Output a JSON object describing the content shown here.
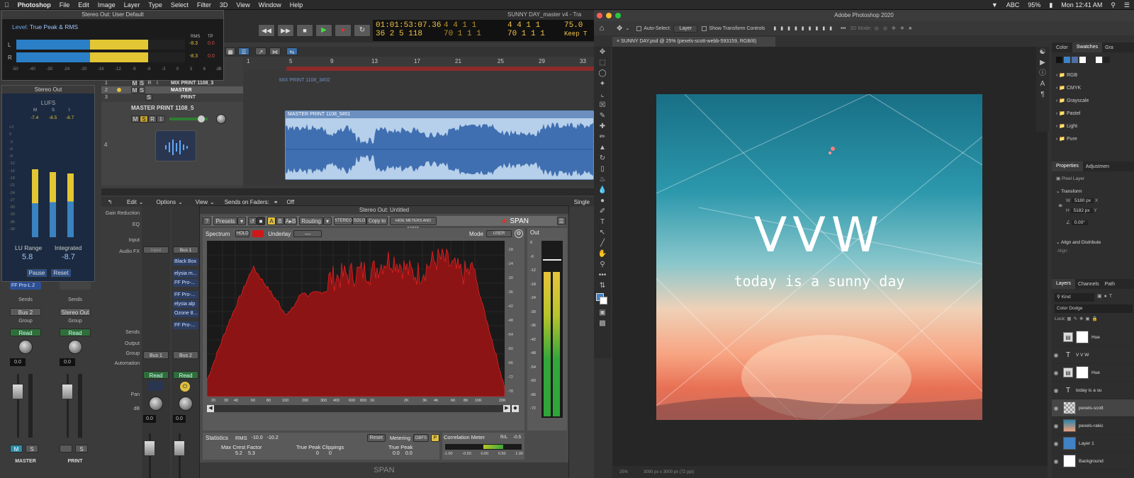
{
  "menubar": {
    "app": "Photoshop",
    "items": [
      "File",
      "Edit",
      "Image",
      "Layer",
      "Type",
      "Select",
      "Filter",
      "3D",
      "View",
      "Window",
      "Help"
    ],
    "battery": "95%",
    "input": "ABC",
    "clock": "Mon 12:41 AM"
  },
  "logic": {
    "window_title": "SUNNY DAY_master v4 - Tra",
    "lcd": {
      "time": "01:01:53:07.36",
      "bars": "36  2  5  118",
      "pos1": "4  4  1  1",
      "pos1b": "70  1  1  1",
      "pos2": "4  4  1  1",
      "pos2b": "70  1  1  1",
      "tempo": "75.0",
      "keep": "Keep T"
    },
    "ruler": [
      "1",
      "5",
      "9",
      "13",
      "17",
      "21",
      "25",
      "29",
      "33"
    ],
    "tracks": [
      {
        "num": "1",
        "name": "MIX PRINT 1108_3"
      },
      {
        "num": "2",
        "name": "MASTER"
      },
      {
        "num": "3",
        "name": "PRINT"
      }
    ],
    "track4": {
      "num": "4",
      "name": "MASTER PRINT 1108_5",
      "m": "M",
      "s": "S",
      "r": "R",
      "i": "I"
    },
    "region_small": "MIX PRINT 1108_3#02",
    "region_main": "MASTER PRINT 1108_5#01",
    "mixer_bar": {
      "edit": "Edit",
      "options": "Options",
      "view": "View",
      "sends_on": "Sends on Faders:",
      "off": "Off",
      "single": "Single"
    },
    "mixer_labels": [
      "Gain Reduction",
      "EQ",
      "Input",
      "Audio FX",
      "Sends",
      "Output",
      "Group",
      "Automation",
      "Pan",
      "dB"
    ],
    "strip_a": {
      "input": "Input",
      "slots": [
        "FF Pro-L 2"
      ],
      "sends": "Sends",
      "output": "Bus 2",
      "group": "Group",
      "read": "Read",
      "db": "0.0",
      "m": "M",
      "s": "S",
      "name": "MASTER"
    },
    "strip_b": {
      "slots": [],
      "sends": "Sends",
      "output": "Stereo Out",
      "group": "Group",
      "read": "Read",
      "db": "0.0",
      "s": "S",
      "name": "PRINT"
    },
    "strip_c": {
      "input": "Input",
      "output": "Bus 1",
      "read": "Read",
      "db": "0.0"
    },
    "strip_d": {
      "input": "Bus 1",
      "slots": [
        "Black Box",
        "elysia m...",
        "FF Pro-...",
        "FF Pro-...",
        "elysia alp",
        "Ozone 8...",
        "FF Pro-..."
      ],
      "output": "Bus 2",
      "read": "Read",
      "db": "0.0"
    }
  },
  "level_meter": {
    "title": "Stereo Out: User Default",
    "level_label": "Level:",
    "mode": "True Peak & RMS",
    "l": "L",
    "r": "R",
    "rms_l": "-8.3",
    "tp_l": "0.0",
    "rms_r": "-8.3",
    "tp_r": "0.0",
    "rms_h": "RMS",
    "tp_h": "TP",
    "scale": [
      "-50",
      "-40",
      "-30",
      "-24",
      "-20",
      "-16",
      "-12",
      "-9",
      "-6",
      "-3",
      "0",
      "3",
      "6",
      "dB"
    ],
    "l_fill": 0.78,
    "r_fill": 0.78
  },
  "loudness": {
    "title": "Stereo Out",
    "lufs": "LUFS",
    "m": "M",
    "s": "S",
    "i": "I",
    "vm": "-7.4",
    "vs": "-8.5",
    "vi": "-8.7",
    "scale": [
      "+3",
      "0",
      "-3",
      "-6",
      "-9",
      "-12",
      "-15",
      "-18",
      "-21",
      "-24",
      "-27",
      "-30",
      "-33",
      "-36",
      "-39"
    ],
    "lu_range_label": "LU Range",
    "lu_range": "5.8",
    "integrated_label": "Integrated",
    "integrated": "-8.7",
    "pause": "Pause",
    "reset": "Reset"
  },
  "span": {
    "title": "Stereo Out: Untitled",
    "presets": "Presets",
    "a": "A",
    "b": "B",
    "atob": "A▸B",
    "routing": "Routing",
    "stereo": "STEREO",
    "solo": "SOLO",
    "copy": "Copy to",
    "hide": "HIDE METERS AND STATS",
    "brand": "SPAN",
    "spectrum": "Spectrum",
    "hold": "HOLD",
    "underlay": "Underlay",
    "underlay_val": "—",
    "mode": "Mode",
    "mode_val": "USER",
    "out": "Out",
    "db_scale": [
      "-18",
      "-24",
      "-30",
      "-36",
      "-42",
      "-48",
      "-54",
      "-60",
      "-66",
      "-72",
      "-78"
    ],
    "freq_scale": [
      "20",
      "30",
      "40",
      "60",
      "80",
      "100",
      "200",
      "300",
      "400",
      "600",
      "800",
      "1K",
      "2K",
      "3K",
      "4K",
      "6K",
      "8K",
      "10K",
      "20K"
    ],
    "statistics": "Statistics",
    "rms": "RMS",
    "rms_l": "-10.0",
    "rms_r": "-10.2",
    "reset": "Reset",
    "metering": "Metering",
    "metering_val": "DBFS",
    "p": "P",
    "corr": "Correlation Meter",
    "rl": "R/L",
    "corr_val": "-0.5",
    "max_crest": "Max Crest Factor",
    "mc_l": "5.2",
    "mc_r": "5.3",
    "tp_clip": "True Peak Clippings",
    "tc_l": "0",
    "tc_r": "0",
    "true_peak": "True Peak",
    "tp_l": "0.0",
    "tp_r": "0.0",
    "corr_scale": [
      "-1.00",
      "-0.50",
      "0.00",
      "0.50",
      "1.00"
    ],
    "footer": "SPAN",
    "out_scale": [
      "0",
      "-6",
      "-12",
      "-18",
      "-24",
      "-30",
      "-36",
      "-42",
      "-48",
      "-54",
      "-60",
      "-66",
      "-72"
    ]
  },
  "photoshop": {
    "title": "Adobe Photoshop 2020",
    "auto_select": "Auto-Select:",
    "layer_sel": "Layer",
    "show_transform": "Show Transform Controls",
    "mode_3d": "3D Mode:",
    "doc_tab": "SUNNY DAY.psd @ 25% (pexels-scott-webb-593159, RGB/8)",
    "art": {
      "title": "VVW",
      "subtitle": "today is a sunny day"
    },
    "status": {
      "zoom": "25%",
      "size": "3000 px x 3000 px (72 ppi)"
    },
    "swatches": {
      "tab_color": "Color",
      "tab_swatches": "Swatches",
      "tab_gr": "Gra",
      "groups": [
        "RGB",
        "CMYK",
        "Grayscale",
        "Pastel",
        "Light",
        "Pure"
      ]
    },
    "properties": {
      "tab": "Properties",
      "tab2": "Adjustmen",
      "pixel_layer": "Pixel Layer",
      "transform": "Transform",
      "w_label": "W",
      "w": "5180 px",
      "x": "X",
      "h_label": "H",
      "h": "5182 px",
      "y": "Y",
      "angle": "0.00°",
      "align": "Align and Distribute",
      "align_label": "Align:"
    },
    "layers": {
      "tab": "Layers",
      "tab2": "Channels",
      "tab3": "Path",
      "kind": "Kind",
      "blend": "Color Dodge",
      "lock": "Lock:",
      "items": [
        {
          "name": "Hue",
          "type": "adj",
          "vis": false
        },
        {
          "name": "V V W",
          "type": "text",
          "vis": true
        },
        {
          "name": "Hue",
          "type": "adj",
          "vis": true
        },
        {
          "name": "today is a su",
          "type": "text",
          "vis": true
        },
        {
          "name": "pexels-scott",
          "type": "image",
          "vis": true
        },
        {
          "name": "pexels-rakic",
          "type": "photo",
          "vis": true
        },
        {
          "name": "Layer 1",
          "type": "solid",
          "vis": true
        },
        {
          "name": "Background",
          "type": "white",
          "vis": true
        }
      ]
    }
  }
}
